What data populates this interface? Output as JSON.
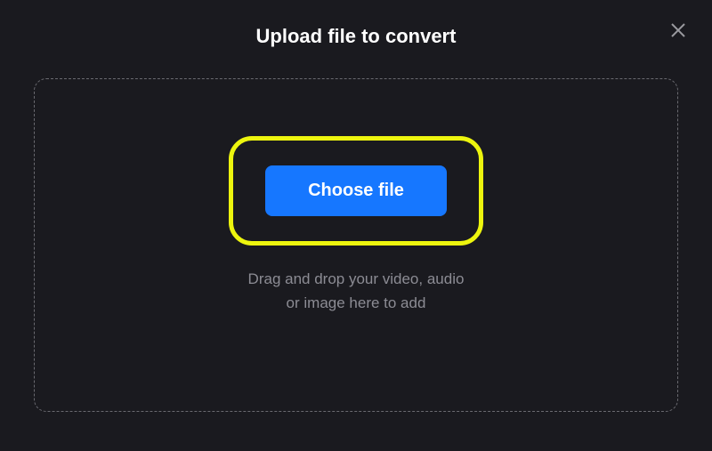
{
  "header": {
    "title": "Upload file to convert"
  },
  "dropzone": {
    "choose_label": "Choose file",
    "hint_line1": "Drag and drop your video, audio",
    "hint_line2": "or image here to add"
  }
}
